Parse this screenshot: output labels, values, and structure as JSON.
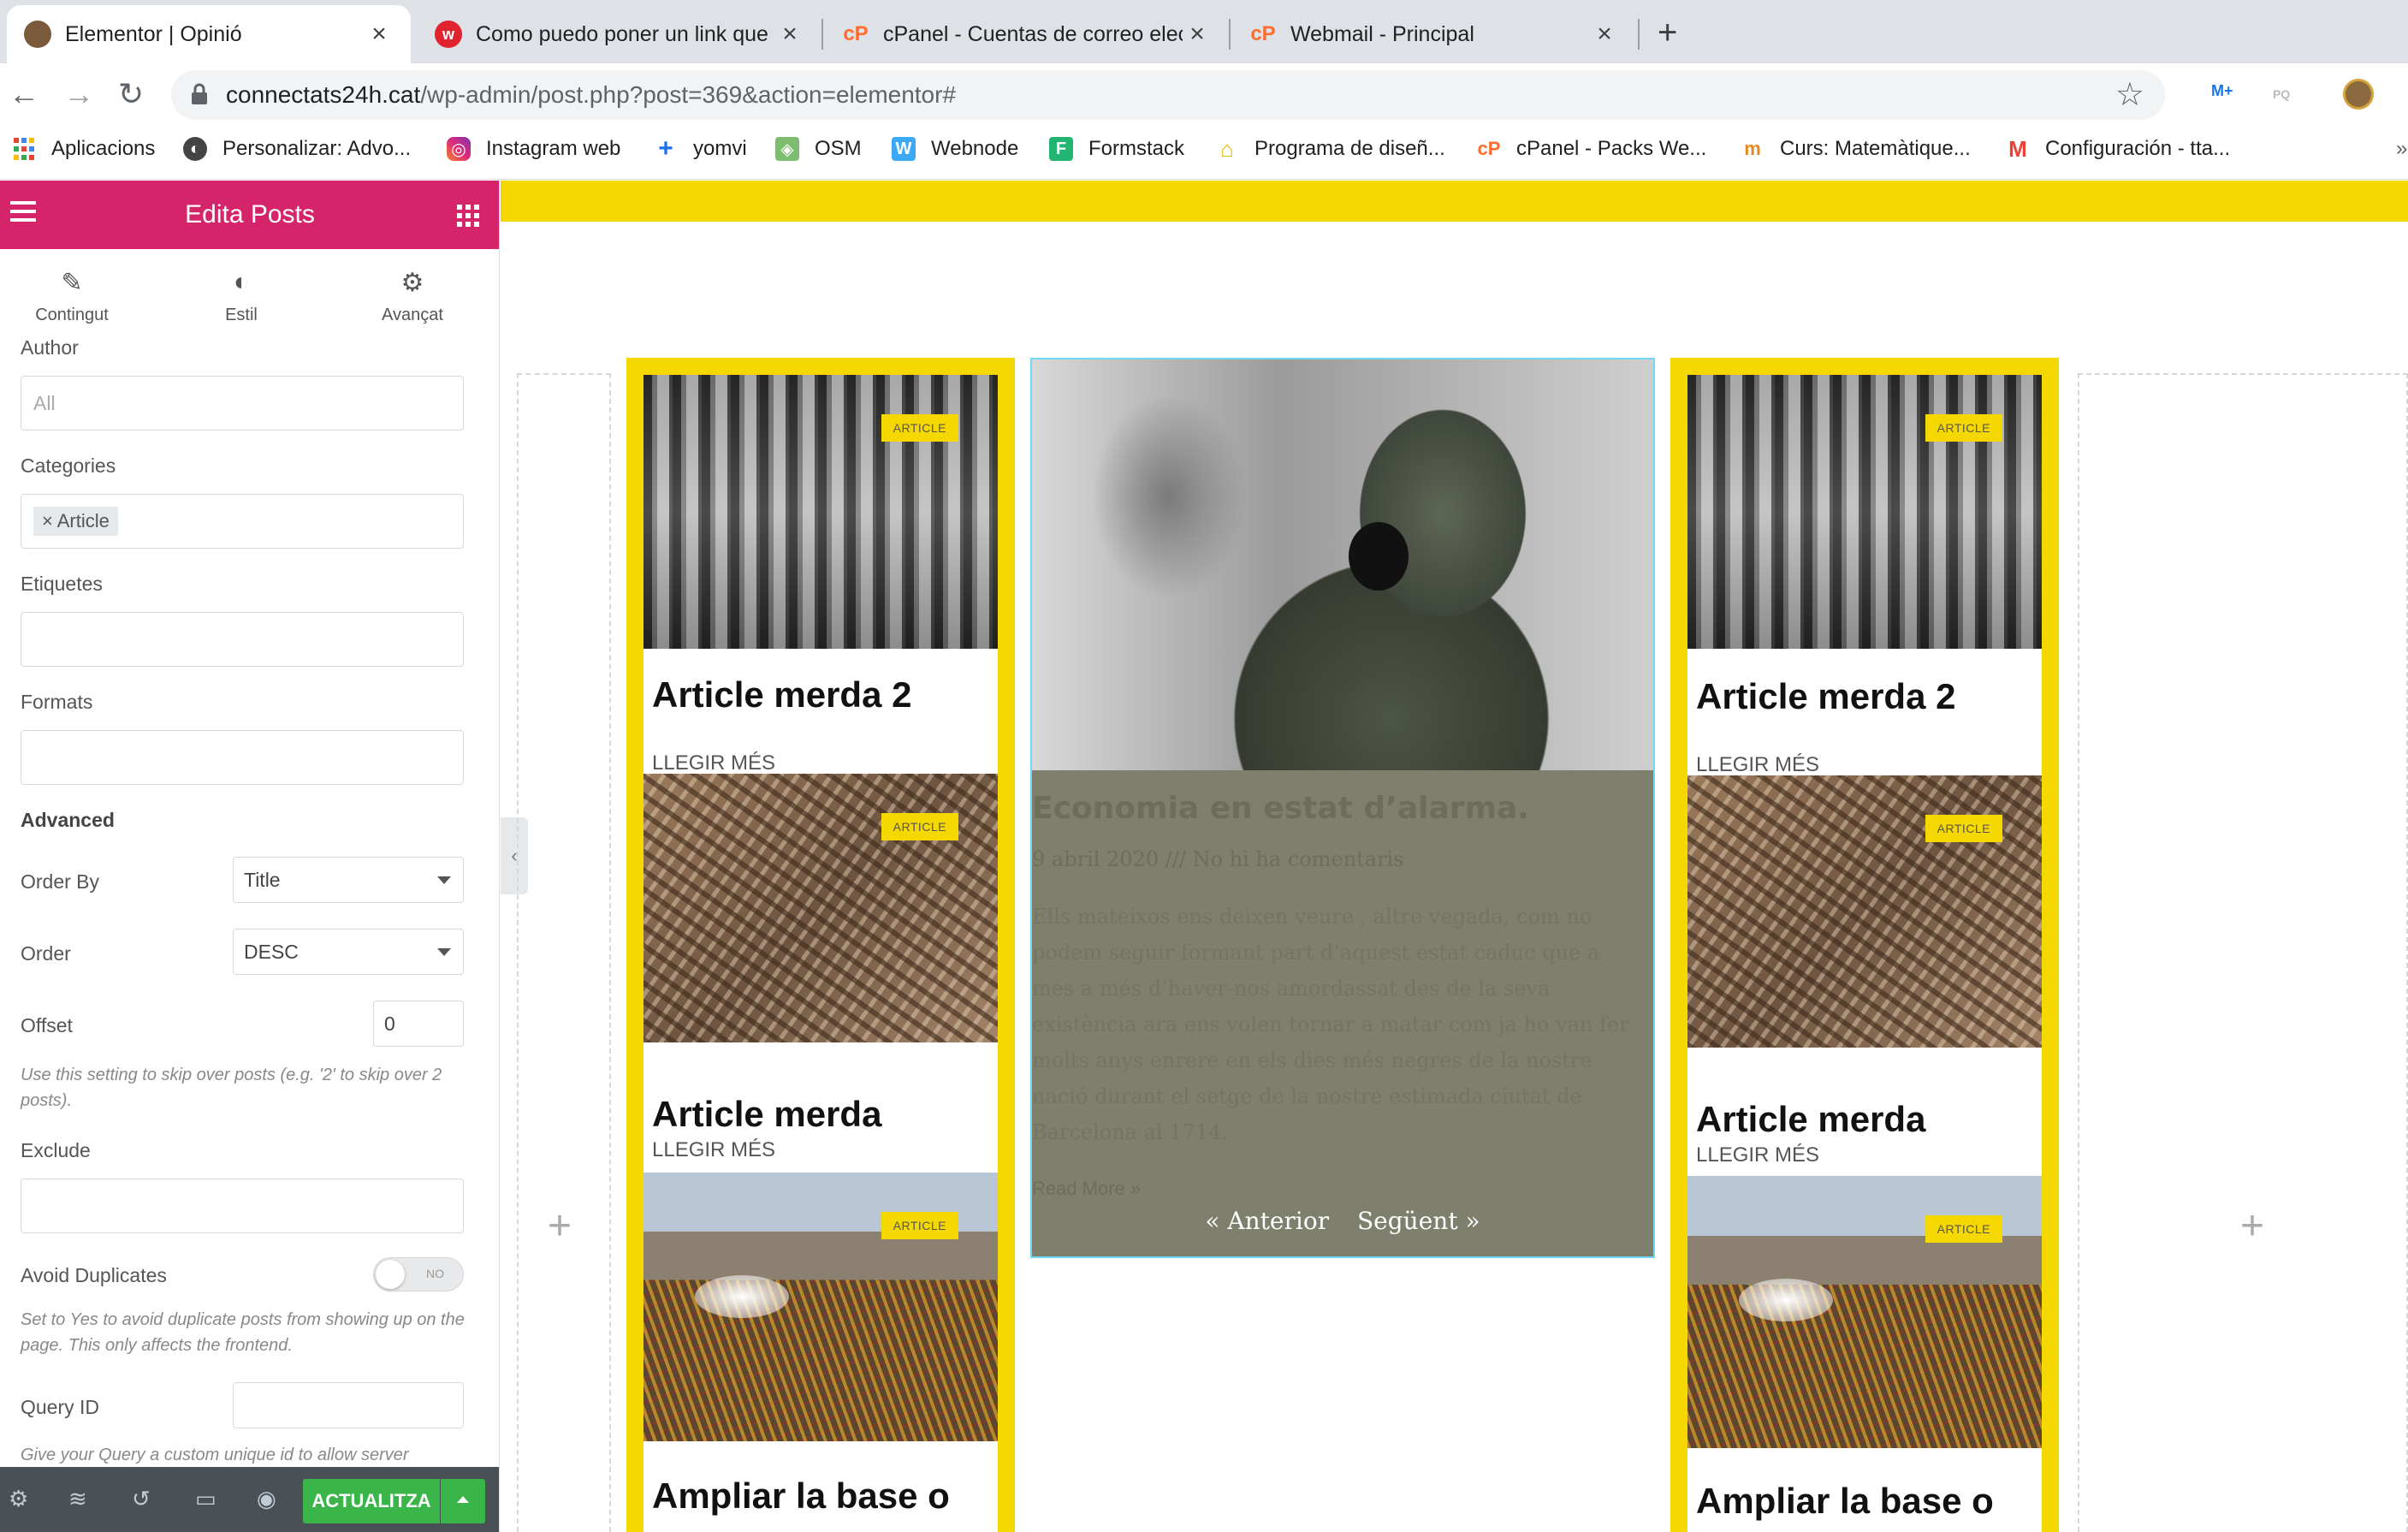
{
  "browser": {
    "tabs": [
      {
        "title": "Elementor | Opinió",
        "active": true
      },
      {
        "title": "Como puedo poner un link que le",
        "active": false
      },
      {
        "title": "cPanel - Cuentas de correo electr",
        "active": false
      },
      {
        "title": "Webmail - Principal",
        "active": false
      }
    ],
    "url_host": "connectats24h.cat",
    "url_path": "/wp-admin/post.php?post=369&action=elementor#",
    "bookmarks": [
      "Aplicacions",
      "Personalizar: Advo...",
      "Instagram web",
      "yomvi",
      "OSM",
      "Webnode",
      "Formstack",
      "Programa de diseñ...",
      "cPanel - Packs We...",
      "Curs: Matemàtique...",
      "Configuración - tta..."
    ]
  },
  "panel": {
    "title": "Edita Posts",
    "tabs": {
      "content": "Contingut",
      "style": "Estil",
      "advanced": "Avançat"
    },
    "author_label": "Author",
    "author_placeholder": "All",
    "categories_label": "Categories",
    "category_tag": "Article",
    "tags_label": "Etiquetes",
    "formats_label": "Formats",
    "advanced_heading": "Advanced",
    "order_by_label": "Order By",
    "order_by_value": "Title",
    "order_label": "Order",
    "order_value": "DESC",
    "offset_label": "Offset",
    "offset_value": "0",
    "offset_note": "Use this setting to skip over posts (e.g. '2' to skip over 2 posts).",
    "exclude_label": "Exclude",
    "avoid_dup_label": "Avoid Duplicates",
    "avoid_dup_toggle": "NO",
    "avoid_dup_note": "Set to Yes to avoid duplicate posts from showing up on the page. This only affects the frontend.",
    "query_id_label": "Query ID",
    "query_id_note": "Give your Query a custom unique id to allow server",
    "update_button": "ACTUALITZA"
  },
  "preview": {
    "badge": "ARTICLE",
    "read_more_label": "LLEGIR MÉS",
    "left_column": [
      {
        "title": "Article merda 2",
        "image": "prison-bars-photo"
      },
      {
        "title": "Article merda",
        "image": "city-aerial-photo"
      },
      {
        "title": "Ampliar la base o",
        "image": "crowd-fountain-photo"
      }
    ],
    "right_column": [
      {
        "title": "Article merda 2",
        "image": "prison-bars-photo"
      },
      {
        "title": "Article merda",
        "image": "city-aerial-photo"
      },
      {
        "title": "Ampliar la base o",
        "image": "crowd-fountain-photo"
      }
    ],
    "featured": {
      "title": "Economia en estat d’alarma.",
      "meta": "9 abril 2020 /// No hi ha comentaris",
      "excerpt": "Ells mateixos ens deixen veure , altre vegada, com no podem seguir formant part d’aquest estat caduc que a més a més d’haver-nos amordassat des de la seva existència ara ens volen tornar a matar com ja ho van fer molts anys enrere en els dies més negres de la nostre nació durant el setge de la nostre estimada ciutat de Barcelona al 1714.",
      "read_more": "Read More »",
      "prev": "« Anterior",
      "next": "Següent »"
    }
  },
  "colors": {
    "elementor_pink": "#d6246b",
    "accent_yellow": "#f5d800",
    "update_green": "#39b54a",
    "featured_overlay": "#7f7f6d"
  }
}
